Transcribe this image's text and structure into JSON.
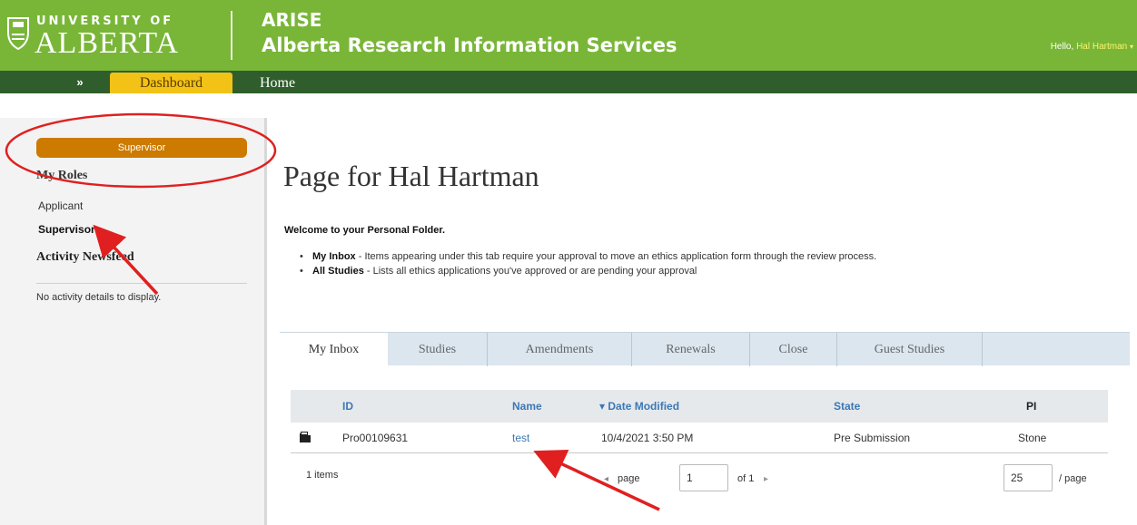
{
  "header": {
    "logo_top": "UNIVERSITY OF",
    "logo_main": "ALBERTA",
    "app_short": "ARISE",
    "app_long": "Alberta Research Information Services",
    "hello_prefix": "Hello,",
    "user_name": "Hal Hartman",
    "user_menu_caret": "▾",
    "background_color": "#79b638"
  },
  "nav": {
    "expand_icon": "»",
    "tabs": [
      {
        "label": "Dashboard",
        "active": true
      },
      {
        "label": "Home",
        "active": false
      }
    ],
    "background_color": "#2f5e2c",
    "active_tab_color": "#f2c217"
  },
  "sidebar": {
    "role_button": "Supervisor",
    "my_roles_title": "My Roles",
    "roles": [
      {
        "label": "Applicant",
        "selected": false
      },
      {
        "label": "Supervisors",
        "selected": true
      }
    ],
    "activity_title": "Activity Newsfeed",
    "activity_empty": "No activity details to display.",
    "role_button_color": "#cc7a00"
  },
  "main": {
    "title": "Page for Hal Hartman",
    "welcome": "Welcome to your Personal Folder.",
    "bullets": [
      {
        "term": "My Inbox",
        "text": " - Items appearing under this tab require your approval to move an ethics application form through the review process."
      },
      {
        "term": "All Studies",
        "text": " - Lists all ethics applications you've approved or are pending your approval"
      }
    ],
    "tabs": [
      {
        "label": "My Inbox",
        "active": true
      },
      {
        "label": "Studies",
        "active": false
      },
      {
        "label": "Amendments",
        "active": false
      },
      {
        "label": "Renewals",
        "active": false
      },
      {
        "label": "Close",
        "active": false
      },
      {
        "label": "Guest Studies",
        "active": false
      }
    ],
    "table": {
      "columns": [
        "ID",
        "Name",
        "▾ Date Modified",
        "State",
        "PI"
      ],
      "rows": [
        {
          "icon": "folder-icon",
          "id": "Pro00109631",
          "name": "test",
          "date_modified": "10/4/2021 3:50 PM",
          "state": "Pre Submission",
          "pi": "Stone"
        }
      ],
      "link_color": "#3b78b5"
    },
    "pager": {
      "items_count": "1 items",
      "prev_icon": "◂",
      "page_label": "page",
      "page_value": "1",
      "of_label": "of 1",
      "next_icon": "▸",
      "page_size": "25",
      "per_page_label": "/ page"
    }
  },
  "annotations": {
    "color": "#e02020",
    "items": [
      "circle-highlight",
      "arrow-to-supervisors",
      "arrow-to-test-link"
    ]
  }
}
